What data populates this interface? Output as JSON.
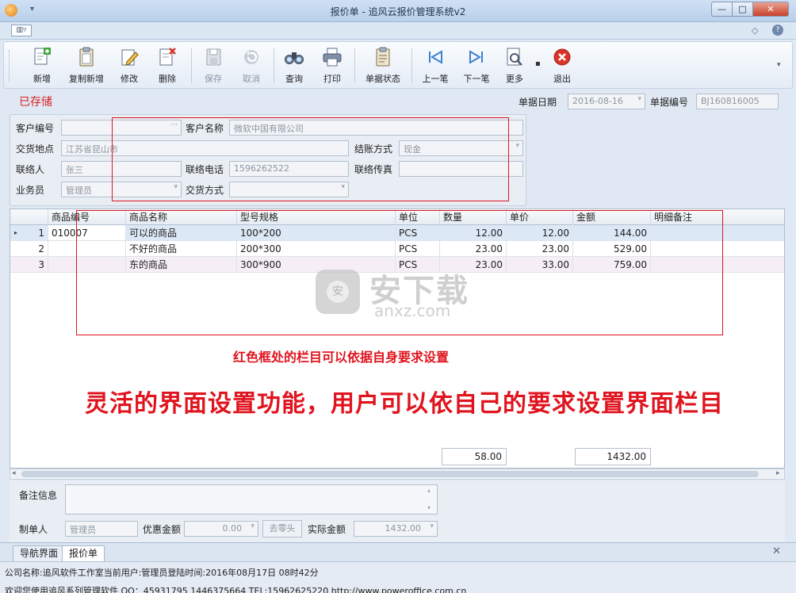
{
  "window": {
    "title": "报价单 - 追风云报价管理系统v2",
    "min_glyph": "—",
    "max_glyph": "□",
    "close_glyph": "✕",
    "layout_toggle_glyph": "▥▿"
  },
  "toolbar": {
    "buttons": [
      {
        "label": "新增",
        "icon": "new-doc-icon"
      },
      {
        "label": "复制新增",
        "icon": "copy-doc-icon"
      },
      {
        "label": "修改",
        "icon": "edit-pen-icon"
      },
      {
        "label": "删除",
        "icon": "delete-doc-icon"
      },
      {
        "label": "保存",
        "icon": "save-disk-icon"
      },
      {
        "label": "取消",
        "icon": "undo-arrow-icon"
      },
      {
        "label": "查询",
        "icon": "binoculars-icon"
      },
      {
        "label": "打印",
        "icon": "printer-icon"
      },
      {
        "label": "单据状态",
        "icon": "clipboard-icon"
      },
      {
        "label": "上一笔",
        "icon": "prev-record-icon"
      },
      {
        "label": "下一笔",
        "icon": "next-record-icon"
      },
      {
        "label": "更多",
        "icon": "magnifier-doc-icon"
      },
      {
        "label": "退出",
        "icon": "exit-icon"
      }
    ]
  },
  "status": {
    "saved_label": "已存储",
    "doc_date_label": "单据日期",
    "doc_date_value": "2016-08-16",
    "doc_no_label": "单据编号",
    "doc_no_value": "BJ160816005"
  },
  "form": {
    "customer_no_label": "客户编号",
    "customer_no_value": "",
    "customer_no_dots": "···",
    "customer_name_label": "客户名称",
    "customer_name_value": "微软中国有限公司",
    "delivery_place_label": "交货地点",
    "delivery_place_value": "江苏省昆山市",
    "settlement_label": "结账方式",
    "settlement_value": "现金",
    "contact_label": "联络人",
    "contact_value": "张三",
    "phone_label": "联络电话",
    "phone_value": "1596262522",
    "fax_label": "联络传真",
    "fax_value": "",
    "salesman_label": "业务员",
    "salesman_value": "管理员",
    "delivery_method_label": "交货方式",
    "delivery_method_value": ""
  },
  "grid": {
    "columns": [
      "商品编号",
      "商品名称",
      "型号规格",
      "单位",
      "数量",
      "单价",
      "金额",
      "明细备注"
    ],
    "rows": [
      {
        "idx": "1",
        "code": "010007",
        "name": "可以的商品",
        "spec": "100*200",
        "unit": "PCS",
        "qty": "12.00",
        "price": "12.00",
        "amount": "144.00",
        "memo": ""
      },
      {
        "idx": "2",
        "code": "",
        "name": "不好的商品",
        "spec": "200*300",
        "unit": "PCS",
        "qty": "23.00",
        "price": "23.00",
        "amount": "529.00",
        "memo": ""
      },
      {
        "idx": "3",
        "code": "",
        "name": "东的商品",
        "spec": "300*900",
        "unit": "PCS",
        "qty": "23.00",
        "price": "33.00",
        "amount": "759.00",
        "memo": ""
      }
    ],
    "total_qty": "58.00",
    "total_amount": "1432.00",
    "selected_marker": "▸"
  },
  "annotations": {
    "small": "红色框处的栏目可以依据自身要求设置",
    "big": "灵活的界面设置功能，用户可以依自己的要求设置界面栏目"
  },
  "watermark": {
    "cn": "安下载",
    "en": "anxz.com",
    "badge": "安"
  },
  "bottom": {
    "memo_label": "备注信息",
    "maker_label": "制单人",
    "maker_value": "管理员",
    "discount_label": "优惠金额",
    "discount_value": "0.00",
    "round_button": "去零头",
    "actual_label": "实际金额",
    "actual_value": "1432.00"
  },
  "tabs": [
    {
      "label": "导航界面",
      "active": false
    },
    {
      "label": "报价单",
      "active": true
    }
  ],
  "statusbar": {
    "line1": "公司名称:追风软件工作室当前用户:管理员登陆时间:2016年08月17日 08时42分",
    "line2": "欢迎您使用追风系列管理软件 QQ：45931795 1446375664 TEL:15962625220 http://www.poweroffice.com.cn"
  },
  "colors": {
    "accent_red": "#e0141e",
    "selected_row": "#dde8f7",
    "row_alt": "#f6eef6"
  }
}
